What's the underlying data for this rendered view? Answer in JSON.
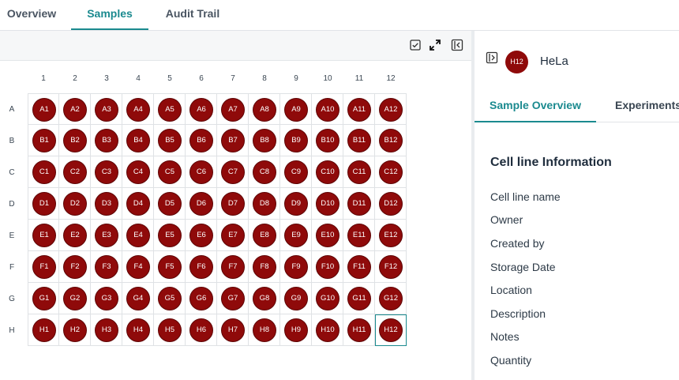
{
  "tabs": [
    "Overview",
    "Samples",
    "Audit Trail"
  ],
  "active_tab": "Samples",
  "toolbar": {
    "icons": [
      "select-all-icon",
      "expand-icon",
      "collapse-panel-icon"
    ]
  },
  "plate": {
    "columns": [
      "1",
      "2",
      "3",
      "4",
      "5",
      "6",
      "7",
      "8",
      "9",
      "10",
      "11",
      "12"
    ],
    "rows": [
      "A",
      "B",
      "C",
      "D",
      "E",
      "F",
      "G",
      "H"
    ],
    "selected_well": "H12",
    "well_color": "#8f0a0a"
  },
  "details": {
    "avatar_text": "H12",
    "name": "HeLa",
    "tabs": [
      "Sample Overview",
      "Experiments"
    ],
    "section_title": "Cell line Information",
    "fields": [
      "Cell line name",
      "Owner",
      "Created by",
      "Storage Date",
      "Location",
      "Description",
      "Notes",
      "Quantity"
    ]
  },
  "colors": {
    "accent": "#1b8a8f",
    "well": "#8f0a0a"
  }
}
